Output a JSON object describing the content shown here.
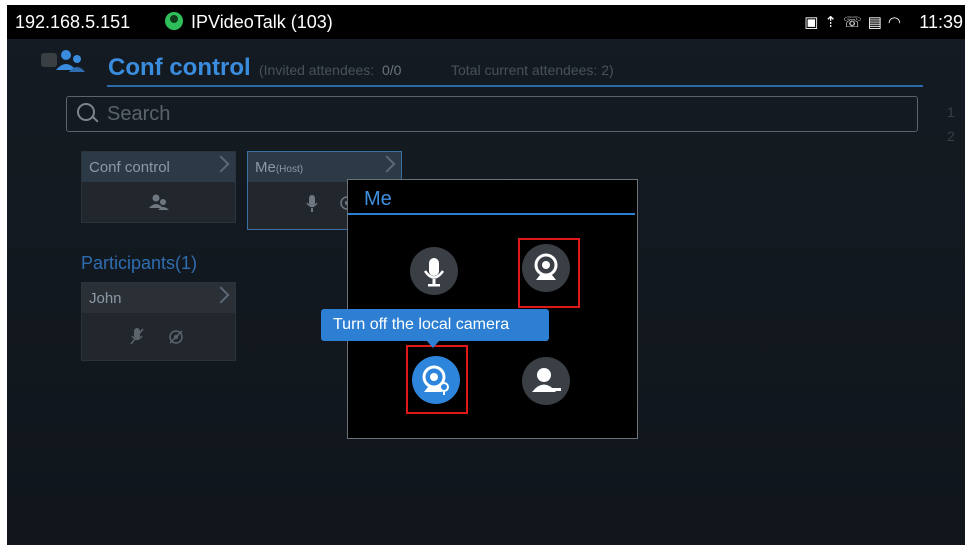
{
  "statusbar": {
    "ip": "192.168.5.151",
    "app_title": "IPVideoTalk (103)",
    "clock": "11:39",
    "icons": [
      "screenshot-icon",
      "upload-icon",
      "call-icon",
      "sim-icon",
      "wifi-icon"
    ]
  },
  "header": {
    "title": "Conf control",
    "invited_label": "(Invited attendees:",
    "invited_value": "0/0",
    "total_label": "Total current attendees:  2)"
  },
  "search": {
    "placeholder": "Search"
  },
  "side_letters": [
    "1",
    "2"
  ],
  "conf_card": {
    "label": "Conf control"
  },
  "me_card": {
    "label": "Me",
    "sublabel": "(Host)"
  },
  "participants": {
    "title": "Participants(1)",
    "items": [
      {
        "name": "John"
      }
    ]
  },
  "dialog": {
    "title": "Me",
    "buttons": [
      "microphone-icon",
      "camera-icon",
      "local-camera-off-icon",
      "presenter-icon"
    ]
  },
  "tooltip": {
    "text": "Turn off the local camera"
  },
  "colors": {
    "accent": "#2d86dc",
    "highlight": "#e01818",
    "background": "#141b22"
  }
}
